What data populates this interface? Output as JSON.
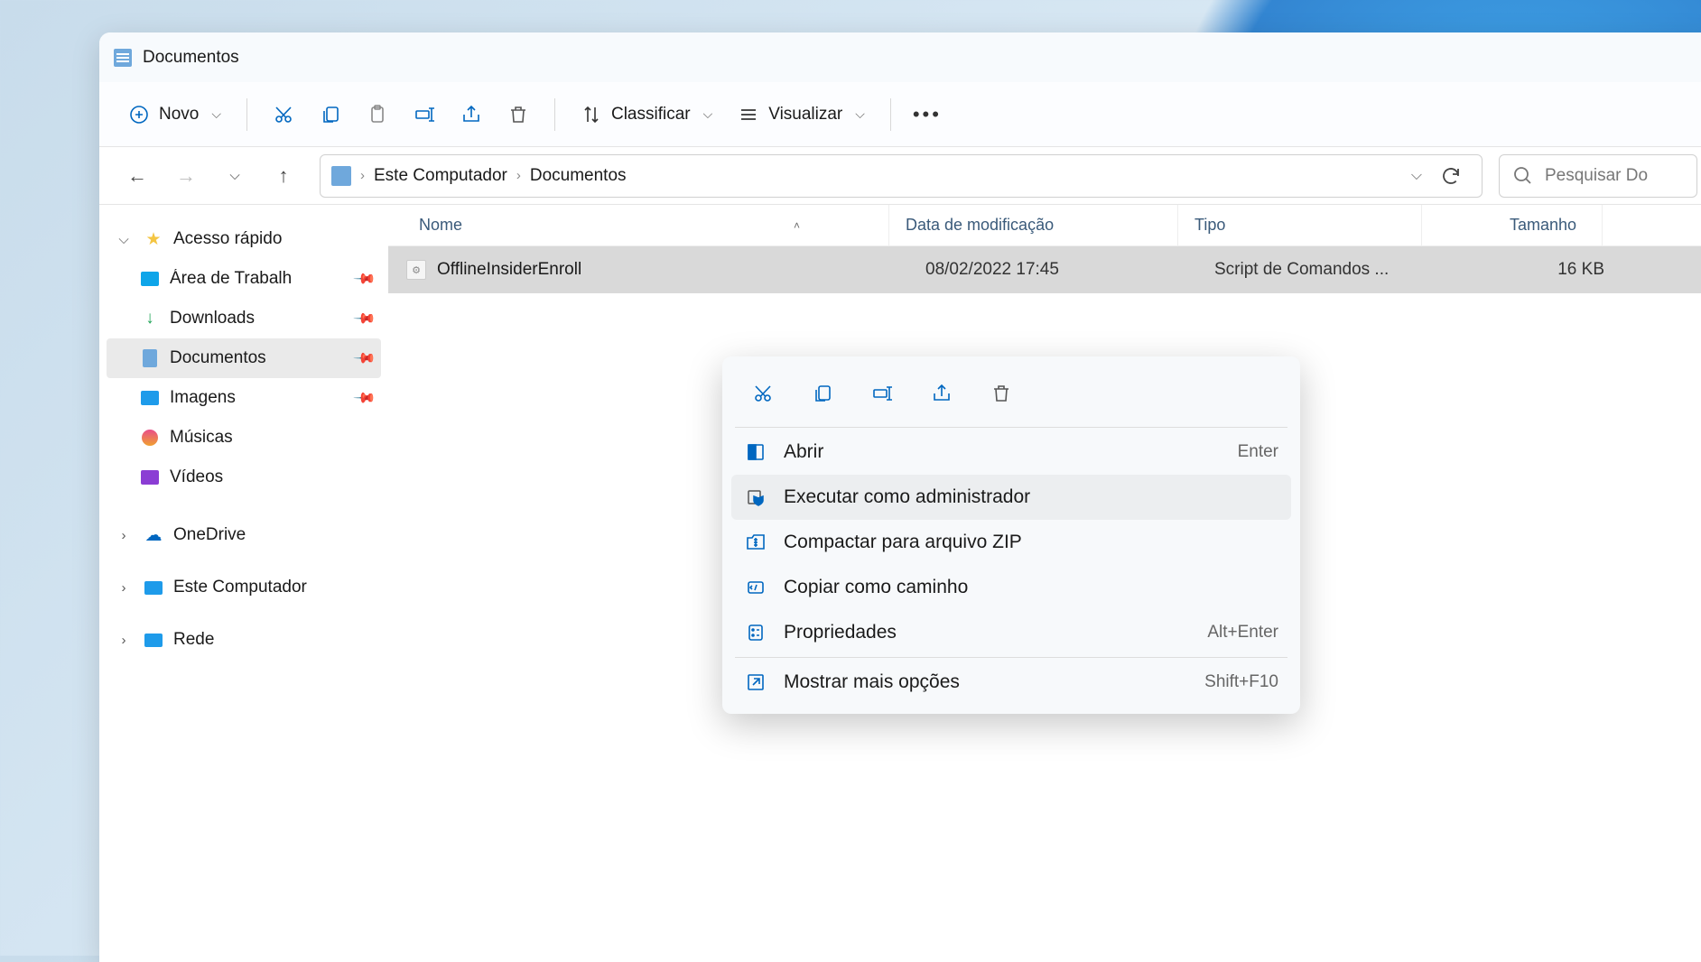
{
  "title": "Documentos",
  "toolbar": {
    "new_label": "Novo",
    "sort_label": "Classificar",
    "view_label": "Visualizar"
  },
  "breadcrumb": {
    "root": "Este Computador",
    "current": "Documentos"
  },
  "search_placeholder": "Pesquisar Do",
  "columns": {
    "name": "Nome",
    "date": "Data de modificação",
    "type": "Tipo",
    "size": "Tamanho"
  },
  "file": {
    "name": "OfflineInsiderEnroll",
    "date": "08/02/2022 17:45",
    "type": "Script de Comandos ...",
    "size": "16 KB"
  },
  "sidebar": {
    "quick": "Acesso rápido",
    "desktop": "Área de Trabalh",
    "downloads": "Downloads",
    "documents": "Documentos",
    "pictures": "Imagens",
    "music": "Músicas",
    "videos": "Vídeos",
    "onedrive": "OneDrive",
    "thispc": "Este Computador",
    "network": "Rede"
  },
  "context_menu": {
    "open": "Abrir",
    "open_accel": "Enter",
    "run_admin": "Executar como administrador",
    "compress": "Compactar para arquivo ZIP",
    "copy_path": "Copiar como caminho",
    "properties": "Propriedades",
    "properties_accel": "Alt+Enter",
    "more": "Mostrar mais opções",
    "more_accel": "Shift+F10"
  }
}
